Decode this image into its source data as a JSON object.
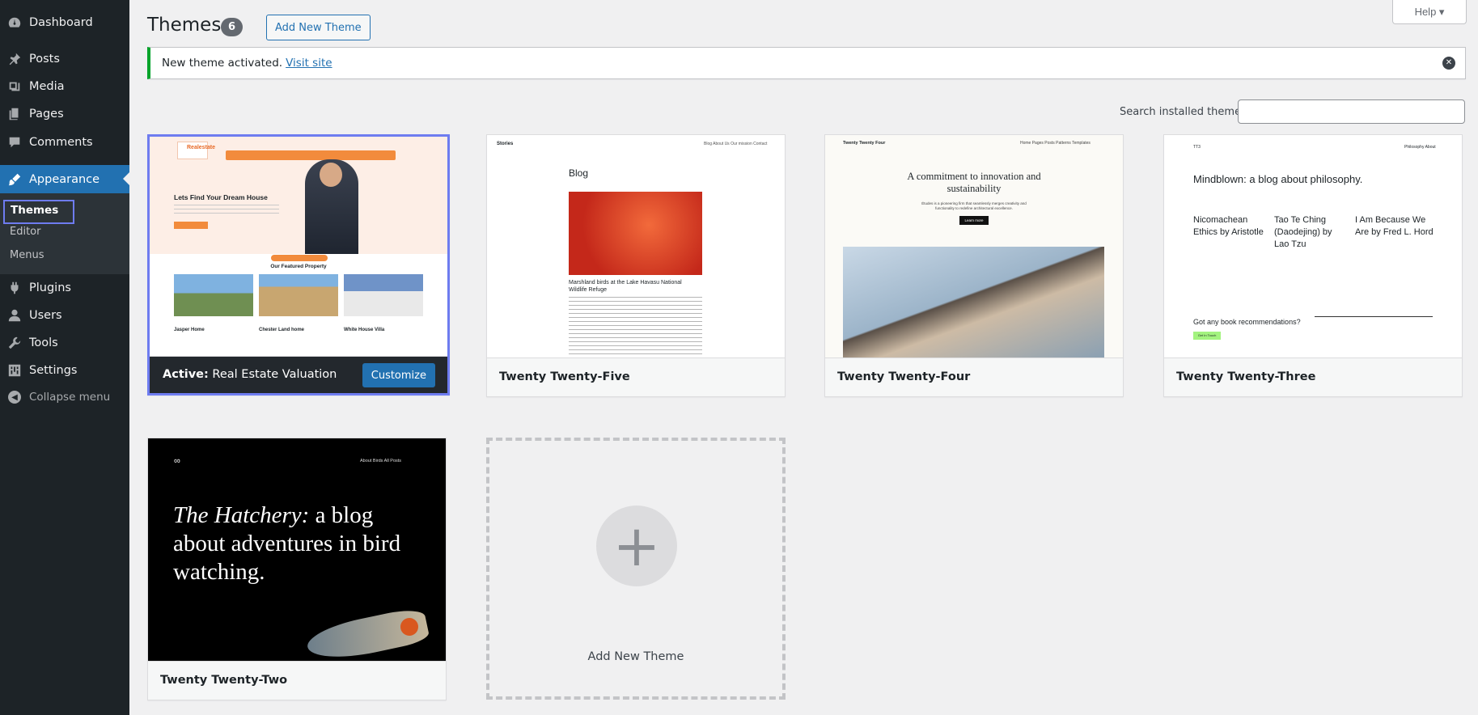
{
  "sidebar": {
    "items": [
      {
        "label": "Dashboard",
        "icon": "dashboard-icon"
      },
      {
        "label": "Posts",
        "icon": "pin-icon"
      },
      {
        "label": "Media",
        "icon": "media-icon"
      },
      {
        "label": "Pages",
        "icon": "pages-icon"
      },
      {
        "label": "Comments",
        "icon": "comment-icon"
      },
      {
        "label": "Appearance",
        "icon": "brush-icon"
      },
      {
        "label": "Plugins",
        "icon": "plug-icon"
      },
      {
        "label": "Users",
        "icon": "user-icon"
      },
      {
        "label": "Tools",
        "icon": "wrench-icon"
      },
      {
        "label": "Settings",
        "icon": "settings-icon"
      },
      {
        "label": "Collapse menu",
        "icon": "collapse-icon"
      }
    ],
    "submenu": [
      "Themes",
      "Editor",
      "Menus"
    ]
  },
  "header": {
    "title": "Themes",
    "count": "6",
    "add_new": "Add New Theme",
    "help": "Help ▾"
  },
  "notice": {
    "text": "New theme activated.",
    "link": "Visit site"
  },
  "search": {
    "label": "Search installed themes",
    "value": ""
  },
  "themes": {
    "active_prefix": "Active:",
    "active_name": "Real Estate Valuation",
    "customize": "Customize",
    "cards": [
      "Twenty Twenty-Five",
      "Twenty Twenty-Four",
      "Twenty Twenty-Three",
      "Twenty Twenty-Two"
    ],
    "add_new": "Add New Theme"
  },
  "previews": {
    "realestate": {
      "logo": "Realestate",
      "hero": "Lets Find Your Dream House",
      "section": "Our Featured Property",
      "props": [
        "Jasper Home",
        "Chester Land home",
        "White House Villa"
      ]
    },
    "tt5": {
      "brand": "Stories",
      "nav": "Blog   About Us   Our mission   Contact",
      "heading": "Blog",
      "caption": "Marshland birds at the Lake Havasu National Wildlife Refuge"
    },
    "tt4": {
      "brand": "Twenty Twenty Four",
      "nav": "Home   Pages   Posts   Patterns   Templates",
      "heading": "A commitment to innovation and sustainability",
      "sub": "Études is a pioneering firm that seamlessly merges creativity and functionality to redefine architectural excellence.",
      "button": "Learn more"
    },
    "tt3": {
      "brand": "TT3",
      "nav": "Philosophy   About",
      "heading": "Mindblown: a blog about philosophy.",
      "posts": [
        "Nicomachean Ethics by Aristotle",
        "Tao Te Ching (Daodejing) by Lao Tzu",
        "I Am Because We Are by Fred L. Hord"
      ],
      "footer": "Got any book recommendations?",
      "button": "Get In Touch"
    },
    "tt2": {
      "nav": "About   Birds   All Posts",
      "heading_italic": "The Hatchery:",
      "heading_rest": " a blog about adventures in bird watching."
    }
  },
  "colors": {
    "accent": "#2271b1",
    "sidebar": "#1d2327",
    "focus": "#6e7cf0",
    "success": "#00a32a"
  }
}
